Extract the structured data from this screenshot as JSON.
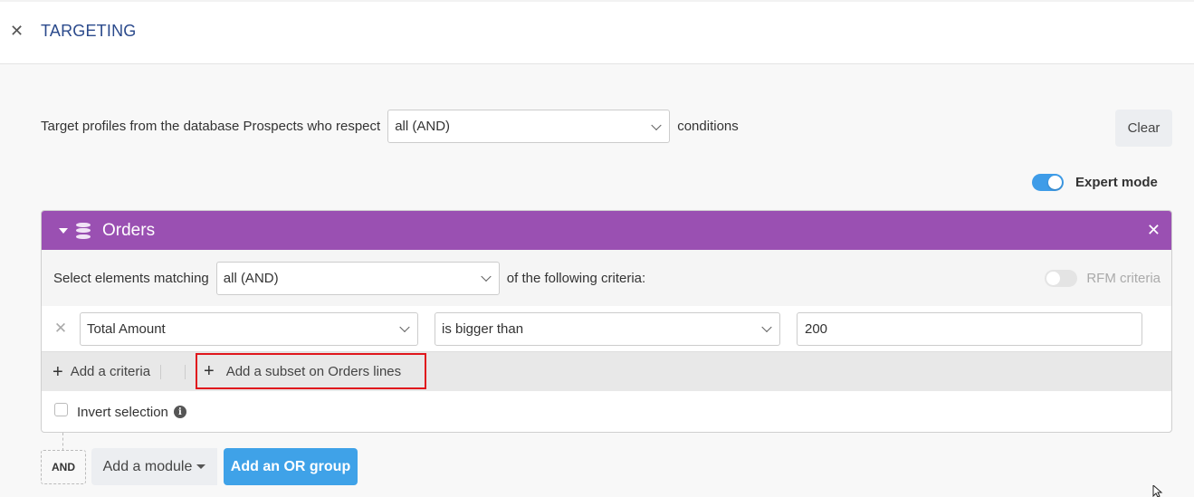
{
  "header": {
    "close_icon": "close-icon",
    "title": "TARGETING"
  },
  "target": {
    "prefix": "Target profiles from the database Prospects who respect",
    "condition_select": "all (AND)",
    "suffix": "conditions"
  },
  "toolbar": {
    "clear_label": "Clear",
    "expert_mode_label": "Expert mode",
    "expert_mode_on": true
  },
  "module": {
    "title": "Orders",
    "icon": "database-icon",
    "color": "#9a50b2",
    "match_prefix": "Select elements matching",
    "match_select": "all (AND)",
    "match_suffix": "of the following criteria:",
    "rfm_label": "RFM criteria",
    "rfm_on": false,
    "criteria": [
      {
        "field": "Total Amount",
        "operator": "is bigger than",
        "value": "200"
      }
    ],
    "add_criteria_label": "Add a criteria",
    "add_subset_label": "Add a subset on Orders lines",
    "invert_label": "Invert selection",
    "invert_checked": false
  },
  "footer": {
    "and_label": "AND",
    "add_module_label": "Add a module",
    "add_or_group_label": "Add an OR group"
  },
  "colors": {
    "accent_blue": "#3fa2e8",
    "title_blue": "#2b4a8c",
    "highlight_red": "#e0161c"
  }
}
